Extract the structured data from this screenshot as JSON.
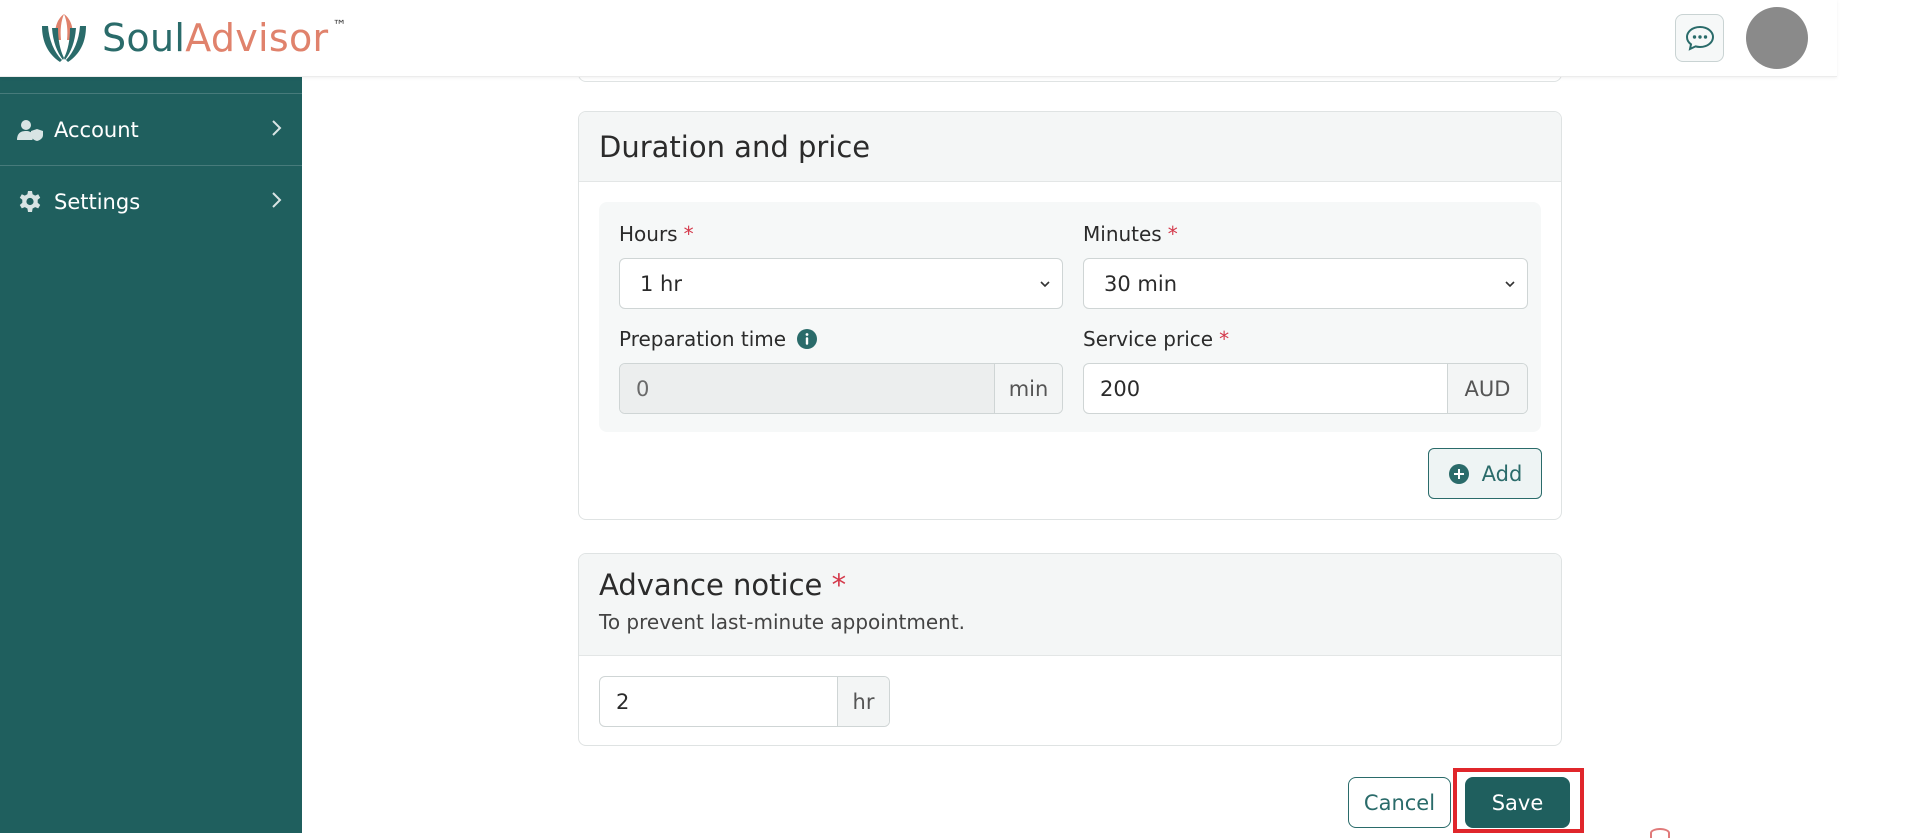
{
  "brand": {
    "name_part1": "Soul",
    "name_part2": "Advisor",
    "trademark": "™"
  },
  "header": {
    "chat_icon": "chat-bubble-icon",
    "avatar_icon": "avatar"
  },
  "sidebar": {
    "items": [
      {
        "label": "Account",
        "icon": "user-shield-icon"
      },
      {
        "label": "Settings",
        "icon": "gear-icon"
      }
    ]
  },
  "duration_price": {
    "title": "Duration and price",
    "hours": {
      "label": "Hours",
      "required": "*",
      "value": "1 hr"
    },
    "minutes": {
      "label": "Minutes",
      "required": "*",
      "value": "30 min"
    },
    "preparation": {
      "label": "Preparation time",
      "value": "0",
      "unit": "min"
    },
    "price": {
      "label": "Service price",
      "required": "*",
      "value": "200",
      "unit": "AUD"
    },
    "add_label": "Add"
  },
  "advance_notice": {
    "title": "Advance notice",
    "required": "*",
    "subtitle": "To prevent last-minute appointment.",
    "value": "2",
    "unit": "hr"
  },
  "actions": {
    "cancel_label": "Cancel",
    "save_label": "Save"
  },
  "colors": {
    "brand_teal": "#1f5f5e",
    "brand_coral": "#e0826c",
    "required_red": "#d4384a",
    "highlight_red": "#e0262b"
  }
}
